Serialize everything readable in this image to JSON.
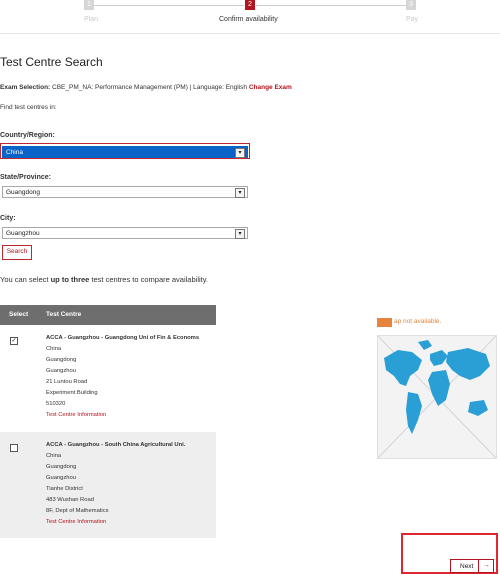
{
  "steps": [
    {
      "num": "1",
      "label": "Plan"
    },
    {
      "num": "2",
      "label": "Confirm availability"
    },
    {
      "num": "3",
      "label": "Pay"
    }
  ],
  "page_title": "Test Centre Search",
  "exam_selection": {
    "label": "Exam Selection:",
    "value": "CBE_PM_NA: Performance Management (PM) | Language: English",
    "change_link": "Change Exam"
  },
  "find_text": "Find test centres in:",
  "country": {
    "label": "Country/Region:",
    "value": "China"
  },
  "state": {
    "label": "State/Province:",
    "value": "Guangdong"
  },
  "city": {
    "label": "City:",
    "value": "Guangzhou"
  },
  "search_button": "Search",
  "compare_text": {
    "prefix": "You can select ",
    "bold": "up to three",
    "suffix": " test centres to compare availability."
  },
  "table": {
    "col_select": "Select",
    "col_centre": "Test Centre",
    "rows": [
      {
        "checked": true,
        "name": "ACCA - Guangzhou - Guangdong Uni of Fin & Economs",
        "lines": [
          "China",
          "Guangdong",
          "Guangzhou",
          "21 Luntou Road",
          "Experiment Building",
          "510320"
        ],
        "info_link": "Test Centre Information"
      },
      {
        "checked": false,
        "name": "ACCA - Guangzhou - South China Agricultural Uni.",
        "lines": [
          "China",
          "Guangdong",
          "Guangzhou",
          "Tianhe District",
          "483 Wushan Road",
          "8F, Dept of Mathematics"
        ],
        "info_link": "Test Centre Information"
      }
    ]
  },
  "map": {
    "message": "ap not available."
  },
  "next_button": {
    "label": "Next",
    "arrow": "→"
  }
}
